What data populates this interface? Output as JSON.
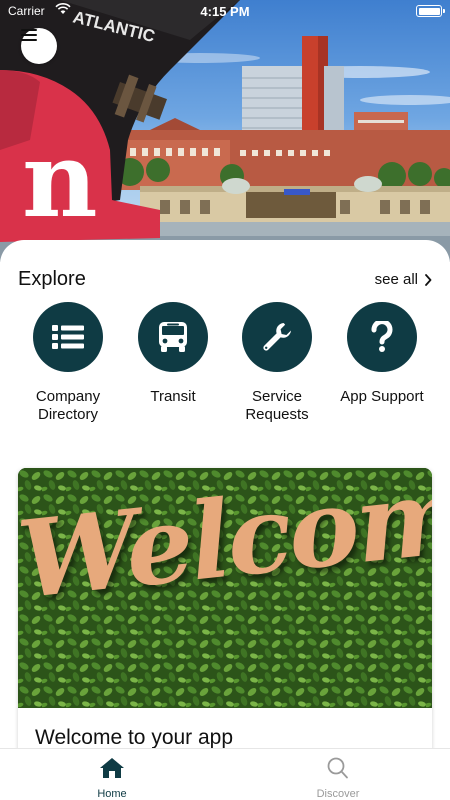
{
  "status_bar": {
    "carrier": "Carrier",
    "time": "4:15 PM",
    "battery_level": 1.0
  },
  "hero": {
    "logo_text": "n",
    "ship_text": "ATLANTIC",
    "menu_icon": "hamburger-menu-icon"
  },
  "explore": {
    "title": "Explore",
    "see_all_label": "see all",
    "items": [
      {
        "label_line1": "Company",
        "label_line2": "Directory",
        "icon": "list-icon"
      },
      {
        "label_line1": "Transit",
        "label_line2": "",
        "icon": "bus-icon"
      },
      {
        "label_line1": "Service",
        "label_line2": "Requests",
        "icon": "wrench-icon"
      },
      {
        "label_line1": "App Support",
        "label_line2": "",
        "icon": "question-mark-icon"
      }
    ]
  },
  "welcome_card": {
    "image_text": "Welcome",
    "title": "Welcome to your app"
  },
  "tab_bar": {
    "home_label": "Home",
    "discover_label": "Discover"
  },
  "colors": {
    "accent": "#0f3b44",
    "inactive": "#9a9a9a",
    "script": "#e7a97c"
  }
}
